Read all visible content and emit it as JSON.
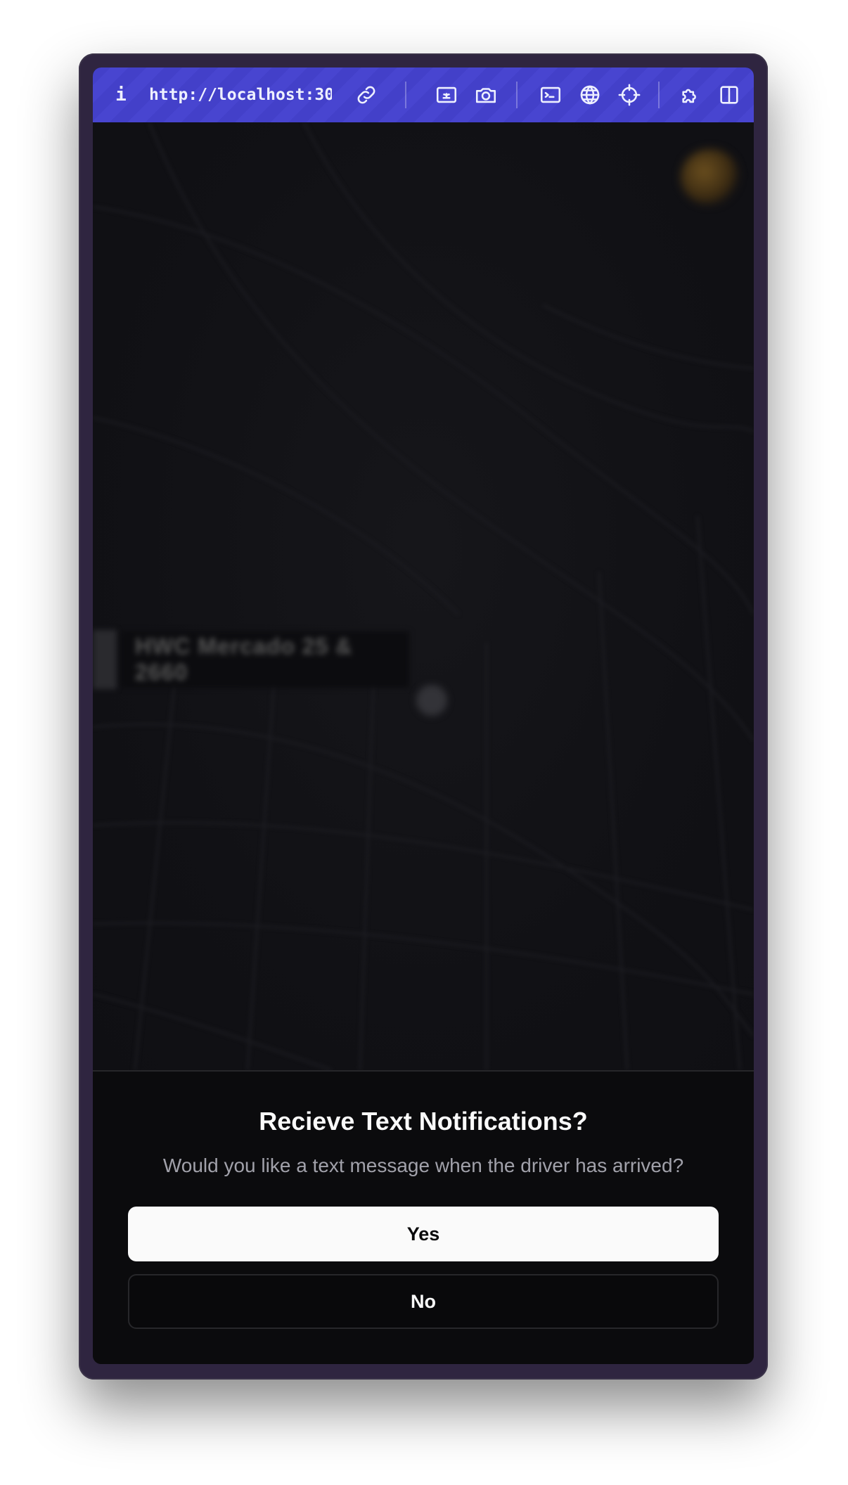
{
  "toolbar": {
    "info_icon": "i",
    "url": "http://localhost:30…",
    "icons": [
      "link-icon",
      "image-icon",
      "camera-icon",
      "terminal-icon",
      "globe-icon",
      "crosshair-icon",
      "extension-icon",
      "sidebar-icon"
    ]
  },
  "map": {
    "label": "HWC Mercado 25 & 2660"
  },
  "dialog": {
    "title": "Recieve Text Notifications?",
    "description": "Would you like a text message when the driver has arrived?",
    "yes_label": "Yes",
    "no_label": "No"
  },
  "colors": {
    "toolbar": "#4340c9",
    "frame": "#2f2540",
    "sheet": "#0b0b0d",
    "primary_button": "#fafafa"
  }
}
